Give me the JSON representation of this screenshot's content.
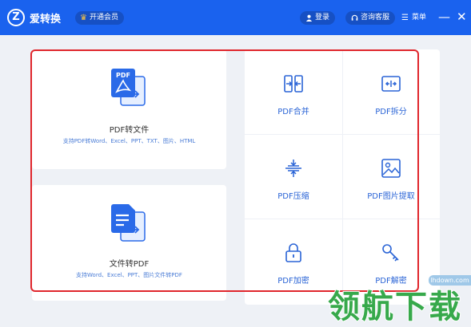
{
  "app": {
    "logo_letter": "Z",
    "name": "爱转换",
    "vip_label": "开通会员",
    "login_label": "登录",
    "support_label": "咨询客服",
    "menu_label": "菜单",
    "minimize_glyph": "—",
    "close_glyph": "✕"
  },
  "colors": {
    "brand": "#1a62ee",
    "link": "#2a64d6",
    "highlight_border": "#e0262c"
  },
  "cards": [
    {
      "title": "PDF转文件",
      "desc": "支持PDF转Word、Excel、PPT、TXT、图片、HTML",
      "icon": "pdf-convert-icon",
      "icon_text": "PDF"
    },
    {
      "title": "文件转PDF",
      "desc": "支持Word、Excel、PPT、图片文件转PDF",
      "icon": "file-to-pdf-icon"
    }
  ],
  "tools": [
    {
      "label": "PDF合并",
      "icon": "merge-icon"
    },
    {
      "label": "PDF拆分",
      "icon": "split-icon"
    },
    {
      "label": "PDF压缩",
      "icon": "compress-icon"
    },
    {
      "label": "PDF图片提取",
      "icon": "image-extract-icon"
    },
    {
      "label": "PDF加密",
      "icon": "lock-icon"
    },
    {
      "label": "PDF解密",
      "icon": "key-icon"
    }
  ],
  "watermark": {
    "url": "lhdown.com",
    "text": "领航下载"
  }
}
